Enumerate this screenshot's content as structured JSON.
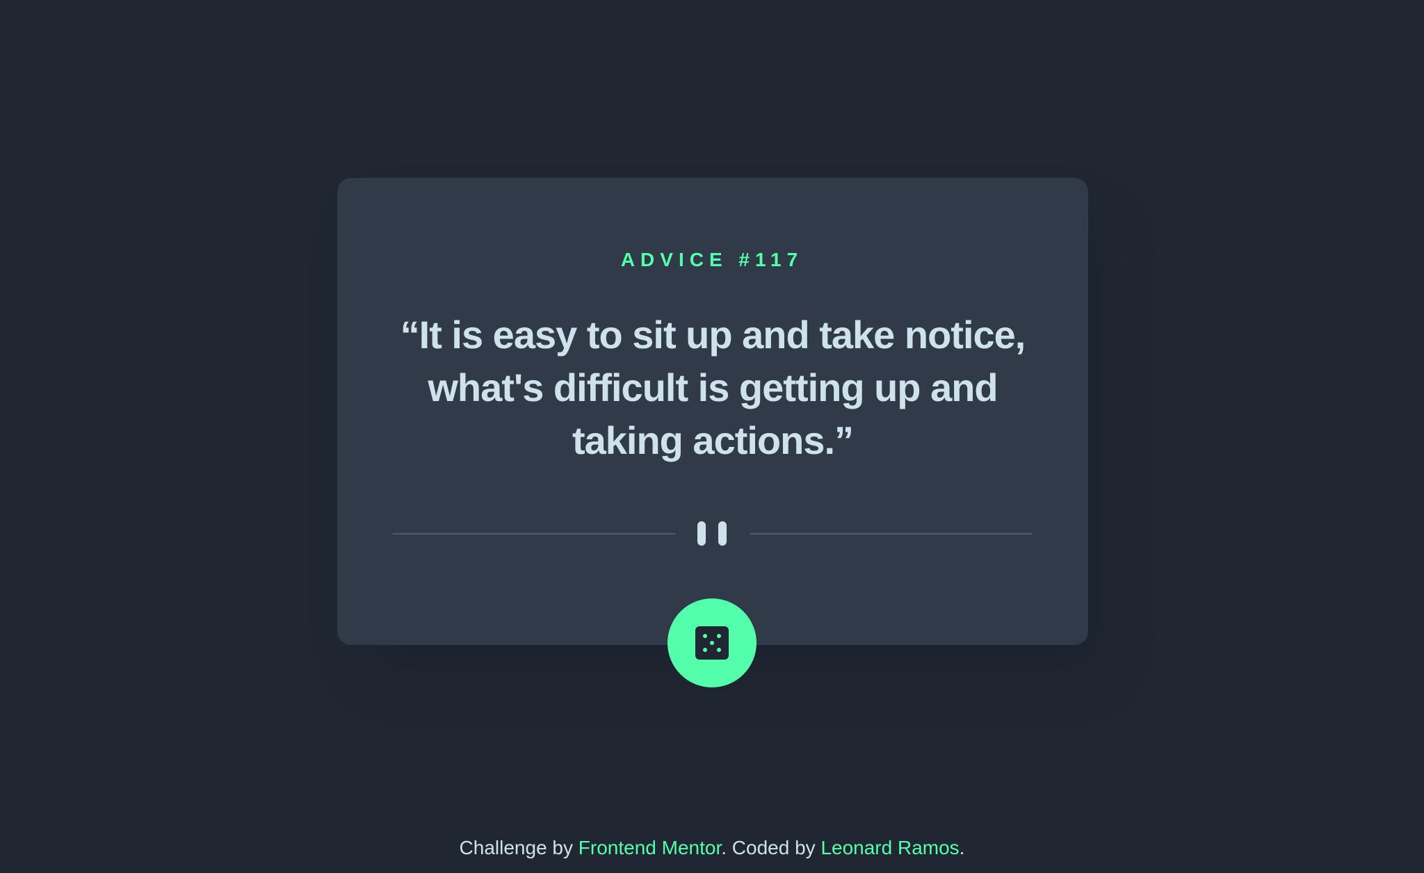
{
  "card": {
    "advice_label": "ADVICE #117",
    "quote": "“It is easy to sit up and take notice, what's difficult is getting up and taking actions.”"
  },
  "button": {
    "icon": "dice-icon"
  },
  "footer": {
    "prefix": "Challenge by ",
    "link1": "Frontend Mentor",
    "middle": ". Coded by ",
    "link2": "Leonard Ramos",
    "suffix": "."
  },
  "colors": {
    "background": "#202733",
    "card": "#313a49",
    "accent": "#53ffaa",
    "text": "#cee3e9",
    "divider": "#4f5d74"
  }
}
